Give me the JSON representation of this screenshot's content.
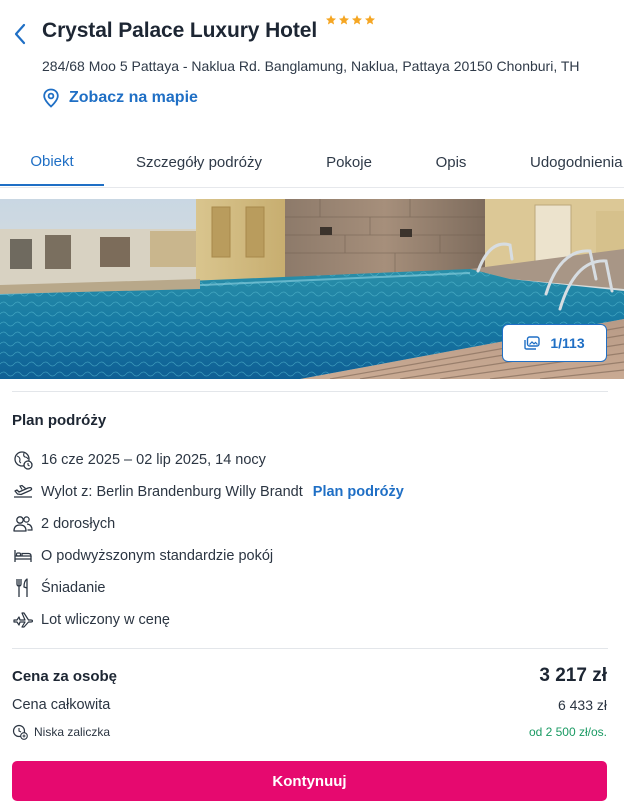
{
  "hotel": {
    "name": "Crystal Palace Luxury Hotel",
    "stars": 4,
    "address": "284/68 Moo 5 Pattaya - Naklua Rd. Banglamung, Naklua, Pattaya 20150 Chonburi, TH",
    "map_link": "Zobacz na mapie"
  },
  "tabs": [
    {
      "label": "Obiekt",
      "active": true
    },
    {
      "label": "Szczegóły podróży",
      "active": false
    },
    {
      "label": "Pokoje",
      "active": false
    },
    {
      "label": "Opis",
      "active": false
    },
    {
      "label": "Udogodnienia",
      "active": false
    }
  ],
  "gallery": {
    "counter": "1/113"
  },
  "trip": {
    "title": "Plan podróży",
    "dates": "16 cze 2025 – 02 lip 2025, 14 nocy",
    "departure": "Wylot z: Berlin Brandenburg Willy Brandt",
    "departure_link": "Plan podróży",
    "guests": "2 dorosłych",
    "room": "O podwyższonym standardzie pokój",
    "board": "Śniadanie",
    "flight": "Lot wliczony w cenę"
  },
  "price": {
    "per_person_label": "Cena za osobę",
    "per_person_value": "3 217 zł",
    "total_label": "Cena całkowita",
    "total_value": "6 433 zł",
    "deposit_label": "Niska zaliczka",
    "deposit_value": "od 2 500 zł/os."
  },
  "cta": {
    "label": "Kontynuuj"
  },
  "colors": {
    "accent": "#1f6fc5",
    "cta": "#e6096f",
    "star": "#f5a623",
    "deposit": "#1a9a63"
  }
}
